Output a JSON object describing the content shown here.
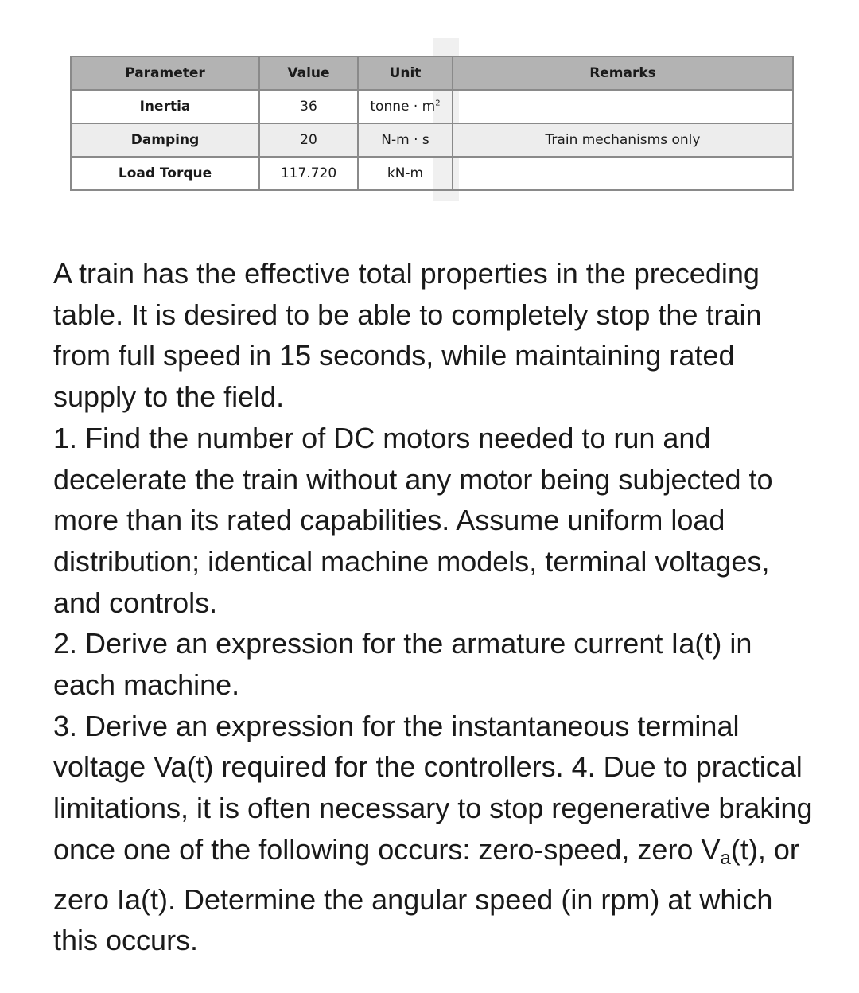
{
  "table": {
    "headers": [
      "Parameter",
      "Value",
      "Unit",
      "Remarks"
    ],
    "rows": [
      {
        "parameter": "Inertia",
        "value": "36",
        "unit": "tonne · m",
        "unit_sup": "2",
        "remarks": ""
      },
      {
        "parameter": "Damping",
        "value": "20",
        "unit": "N-m · s",
        "unit_sup": "",
        "remarks": "Train mechanisms only"
      },
      {
        "parameter": "Load Torque",
        "value": "117.720",
        "unit": "kN-m",
        "unit_sup": "",
        "remarks": ""
      }
    ]
  },
  "problem": {
    "intro": "A train has the effective total properties in the preceding table. It is desired to be able to completely stop the train from full speed in 15 seconds, while maintaining rated supply to the field.",
    "q1": "1. Find the number of DC motors needed to run and decelerate the train without any motor being subjected to more than its rated capabilities. Assume uniform load distribution; identical machine models, terminal voltages, and controls.",
    "q2": "2. Derive an expression for the armature current Ia(t) in each machine.",
    "q3": "3. Derive an expression for the instantaneous terminal voltage Va(t) required for the controllers. 4. Due to practical limitations, it is often necessary to stop regenerative braking once one of the following occurs: zero-speed, zero V",
    "q3_sub": "a",
    "q3_end": "(t), or zero Ia(t). Determine the angular speed (in rpm) at which this occurs."
  }
}
